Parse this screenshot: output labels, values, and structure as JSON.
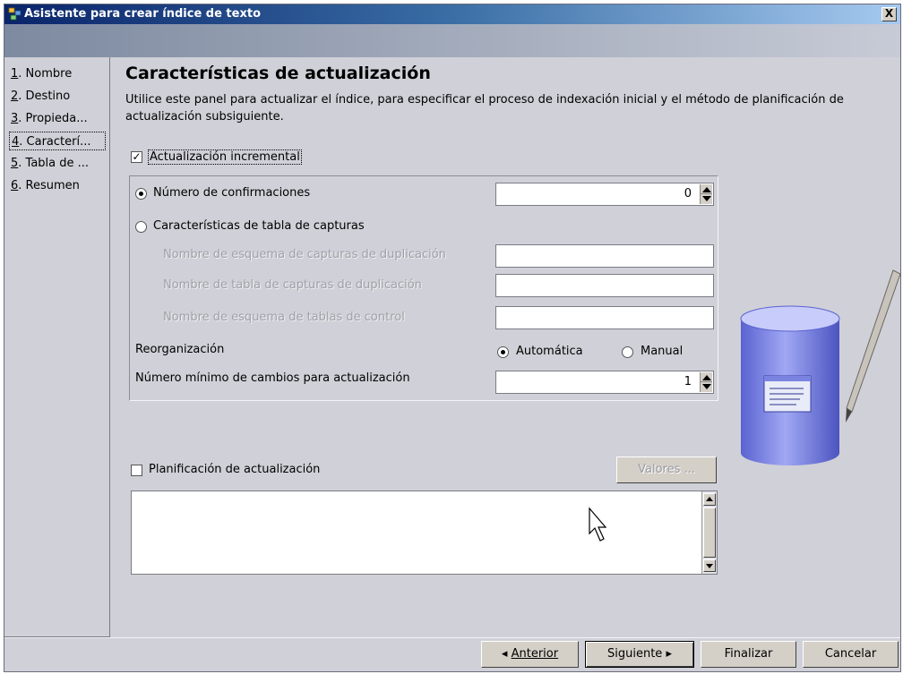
{
  "window": {
    "title": "Asistente para crear índice de texto",
    "close_label": "X"
  },
  "sidebar": {
    "items": [
      {
        "num": "1",
        "label": ". Nombre"
      },
      {
        "num": "2",
        "label": ". Destino"
      },
      {
        "num": "3",
        "label": ". Propieda..."
      },
      {
        "num": "4",
        "label": ". Caracterí..."
      },
      {
        "num": "5",
        "label": ". Tabla de ..."
      },
      {
        "num": "6",
        "label": ". Resumen"
      }
    ],
    "active_index": 3
  },
  "main": {
    "heading": "Características de actualización",
    "description": "Utilice este panel para actualizar el índice, para especificar el proceso de indexación inicial y el método de planificación de actualización subsiguiente.",
    "incremental_update": {
      "label": "Actualización incremental",
      "checked": true
    },
    "commits_radio": {
      "label": "Número de confirmaciones",
      "selected": true,
      "value": "0"
    },
    "capture_radio": {
      "label": "Características de tabla de capturas",
      "selected": false
    },
    "capture_schema": {
      "label": "Nombre de esquema de capturas de duplicación",
      "value": ""
    },
    "capture_table": {
      "label": "Nombre de tabla de capturas de duplicación",
      "value": ""
    },
    "control_schema": {
      "label": "Nombre de esquema de tablas de control",
      "value": ""
    },
    "reorganization": {
      "label": "Reorganización",
      "auto_label": "Automática",
      "manual_label": "Manual",
      "selected": "Automática"
    },
    "min_changes": {
      "label": "Número mínimo de cambios para actualización",
      "value": "1"
    },
    "schedule": {
      "label": "Planificación de actualización",
      "checked": false,
      "settings_button": "Valores ..."
    }
  },
  "footer": {
    "back": "Anterior",
    "next": "Siguiente",
    "finish": "Finalizar",
    "cancel": "Cancelar"
  }
}
